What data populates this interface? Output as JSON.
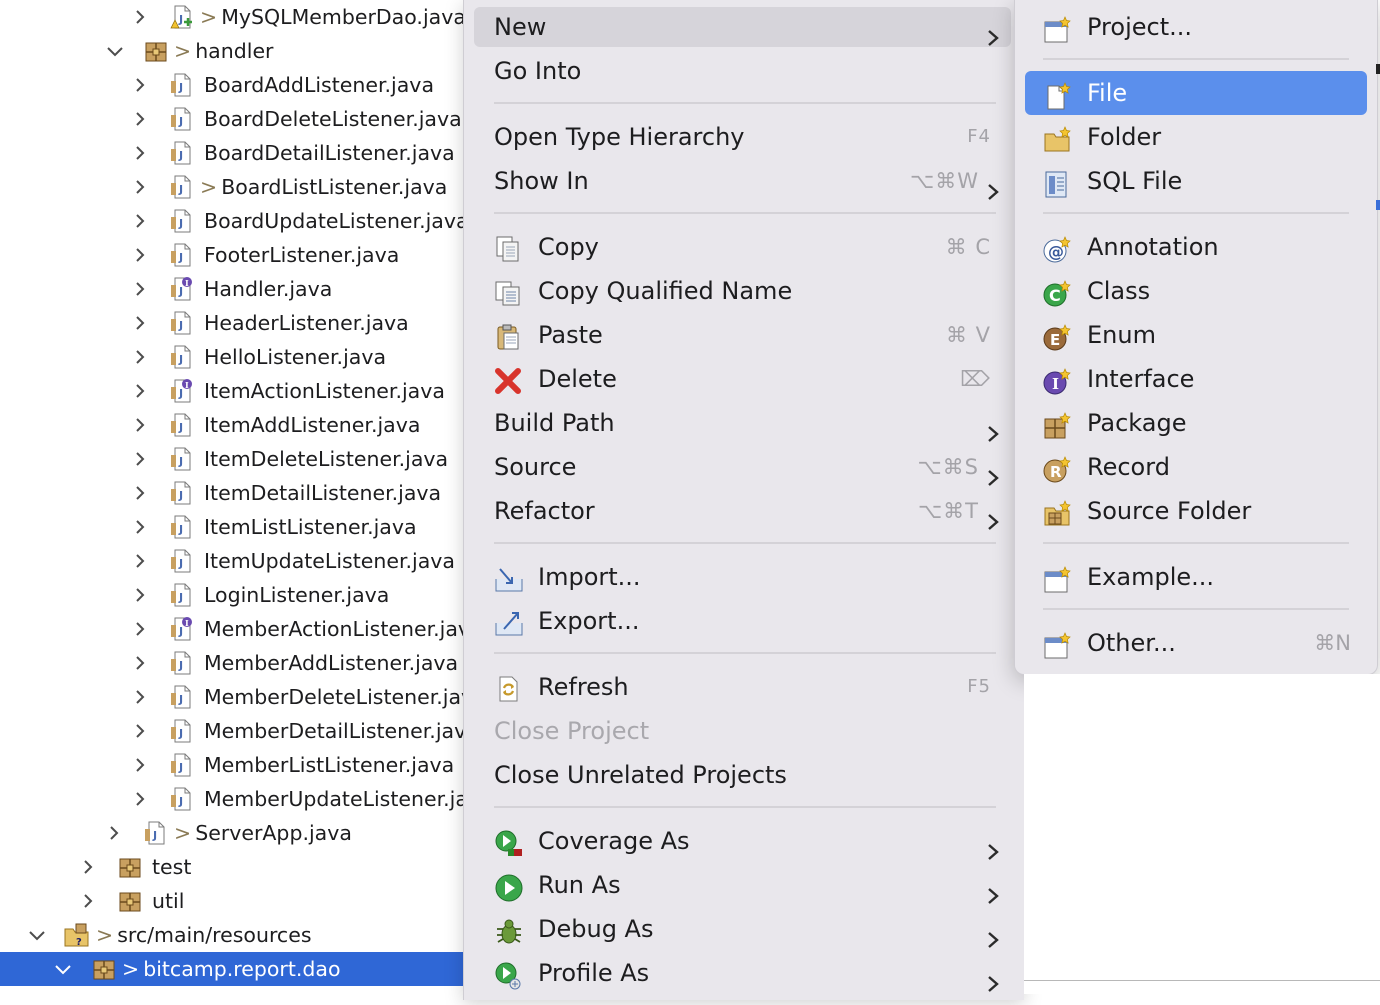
{
  "tree": {
    "rows": [
      {
        "label": "MySQLMemberDao.java",
        "prefix": ">",
        "icon": "java-file-warning-icon"
      },
      {
        "label": "handler",
        "prefix": ">",
        "icon": "package-icon"
      },
      {
        "label": "BoardAddListener.java",
        "prefix": "",
        "icon": "java-file-icon"
      },
      {
        "label": "BoardDeleteListener.java",
        "prefix": "",
        "icon": "java-file-icon"
      },
      {
        "label": "BoardDetailListener.java",
        "prefix": "",
        "icon": "java-file-icon"
      },
      {
        "label": "BoardListListener.java",
        "prefix": ">",
        "icon": "java-file-icon"
      },
      {
        "label": "BoardUpdateListener.java",
        "prefix": "",
        "icon": "java-file-icon"
      },
      {
        "label": "FooterListener.java",
        "prefix": "",
        "icon": "java-file-icon"
      },
      {
        "label": "Handler.java",
        "prefix": "",
        "icon": "java-interface-file-icon"
      },
      {
        "label": "HeaderListener.java",
        "prefix": "",
        "icon": "java-file-icon"
      },
      {
        "label": "HelloListener.java",
        "prefix": "",
        "icon": "java-file-icon"
      },
      {
        "label": "ItemActionListener.java",
        "prefix": "",
        "icon": "java-interface-file-icon"
      },
      {
        "label": "ItemAddListener.java",
        "prefix": "",
        "icon": "java-file-icon"
      },
      {
        "label": "ItemDeleteListener.java",
        "prefix": "",
        "icon": "java-file-icon"
      },
      {
        "label": "ItemDetailListener.java",
        "prefix": "",
        "icon": "java-file-icon"
      },
      {
        "label": "ItemListListener.java",
        "prefix": "",
        "icon": "java-file-icon"
      },
      {
        "label": "ItemUpdateListener.java",
        "prefix": "",
        "icon": "java-file-icon"
      },
      {
        "label": "LoginListener.java",
        "prefix": "",
        "icon": "java-file-icon"
      },
      {
        "label": "MemberActionListener.java",
        "prefix": "",
        "icon": "java-interface-file-icon"
      },
      {
        "label": "MemberAddListener.java",
        "prefix": "",
        "icon": "java-file-icon"
      },
      {
        "label": "MemberDeleteListener.java",
        "prefix": "",
        "icon": "java-file-icon"
      },
      {
        "label": "MemberDetailListener.java",
        "prefix": "",
        "icon": "java-file-icon"
      },
      {
        "label": "MemberListListener.java",
        "prefix": "",
        "icon": "java-file-icon"
      },
      {
        "label": "MemberUpdateListener.java",
        "prefix": "",
        "icon": "java-file-icon"
      },
      {
        "label": "ServerApp.java",
        "prefix": ">",
        "icon": "java-file-icon"
      },
      {
        "label": "test",
        "prefix": "",
        "icon": "package-icon"
      },
      {
        "label": "util",
        "prefix": "",
        "icon": "package-icon"
      },
      {
        "label": "src/main/resources",
        "prefix": ">",
        "icon": "source-folder-icon"
      },
      {
        "label": "bitcamp.report.dao",
        "prefix": ">",
        "icon": "package-icon"
      }
    ]
  },
  "menu": {
    "items": [
      {
        "label": "New",
        "shortcut": "",
        "submenu": true,
        "icon": ""
      },
      {
        "label": "Go Into",
        "shortcut": "",
        "submenu": false,
        "icon": ""
      },
      {
        "label": "Open Type Hierarchy",
        "shortcut": "F4",
        "submenu": false,
        "icon": ""
      },
      {
        "label": "Show In",
        "shortcut": "⌥⌘W",
        "submenu": true,
        "icon": ""
      },
      {
        "label": "Copy",
        "shortcut": "⌘ C",
        "submenu": false,
        "icon": "copy-icon"
      },
      {
        "label": "Copy Qualified Name",
        "shortcut": "",
        "submenu": false,
        "icon": "copy-qualified-name-icon"
      },
      {
        "label": "Paste",
        "shortcut": "⌘ V",
        "submenu": false,
        "icon": "paste-icon"
      },
      {
        "label": "Delete",
        "shortcut": "⌦",
        "submenu": false,
        "icon": "delete-icon"
      },
      {
        "label": "Build Path",
        "shortcut": "",
        "submenu": true,
        "icon": ""
      },
      {
        "label": "Source",
        "shortcut": "⌥⌘S",
        "submenu": true,
        "icon": ""
      },
      {
        "label": "Refactor",
        "shortcut": "⌥⌘T",
        "submenu": true,
        "icon": ""
      },
      {
        "label": "Import...",
        "shortcut": "",
        "submenu": false,
        "icon": "import-icon"
      },
      {
        "label": "Export...",
        "shortcut": "",
        "submenu": false,
        "icon": "export-icon"
      },
      {
        "label": "Refresh",
        "shortcut": "F5",
        "submenu": false,
        "icon": "refresh-icon"
      },
      {
        "label": "Close Project",
        "shortcut": "",
        "submenu": false,
        "icon": ""
      },
      {
        "label": "Close Unrelated Projects",
        "shortcut": "",
        "submenu": false,
        "icon": ""
      },
      {
        "label": "Coverage As",
        "shortcut": "",
        "submenu": true,
        "icon": "coverage-icon"
      },
      {
        "label": "Run As",
        "shortcut": "",
        "submenu": true,
        "icon": "run-icon"
      },
      {
        "label": "Debug As",
        "shortcut": "",
        "submenu": true,
        "icon": "debug-icon"
      },
      {
        "label": "Profile As",
        "shortcut": "",
        "submenu": true,
        "icon": "profile-icon"
      }
    ]
  },
  "submenu": {
    "items": [
      {
        "label": "Project...",
        "shortcut": "",
        "icon": "new-project-icon"
      },
      {
        "label": "File",
        "shortcut": "",
        "icon": "new-file-icon"
      },
      {
        "label": "Folder",
        "shortcut": "",
        "icon": "new-folder-icon"
      },
      {
        "label": "SQL File",
        "shortcut": "",
        "icon": "new-sql-file-icon"
      },
      {
        "label": "Annotation",
        "shortcut": "",
        "icon": "new-annotation-icon"
      },
      {
        "label": "Class",
        "shortcut": "",
        "icon": "new-class-icon"
      },
      {
        "label": "Enum",
        "shortcut": "",
        "icon": "new-enum-icon"
      },
      {
        "label": "Interface",
        "shortcut": "",
        "icon": "new-interface-icon"
      },
      {
        "label": "Package",
        "shortcut": "",
        "icon": "new-package-icon"
      },
      {
        "label": "Record",
        "shortcut": "",
        "icon": "new-record-icon"
      },
      {
        "label": "Source Folder",
        "shortcut": "",
        "icon": "new-source-folder-icon"
      },
      {
        "label": "Example...",
        "shortcut": "",
        "icon": "new-example-icon"
      },
      {
        "label": "Other...",
        "shortcut": "⌘N",
        "icon": "new-other-icon"
      }
    ]
  },
  "colors": {
    "selection": "#2f67d6",
    "submenu_highlight": "#5b8fec",
    "menu_background": "#e9e7ec",
    "disabled_text": "#a9a8ad"
  }
}
